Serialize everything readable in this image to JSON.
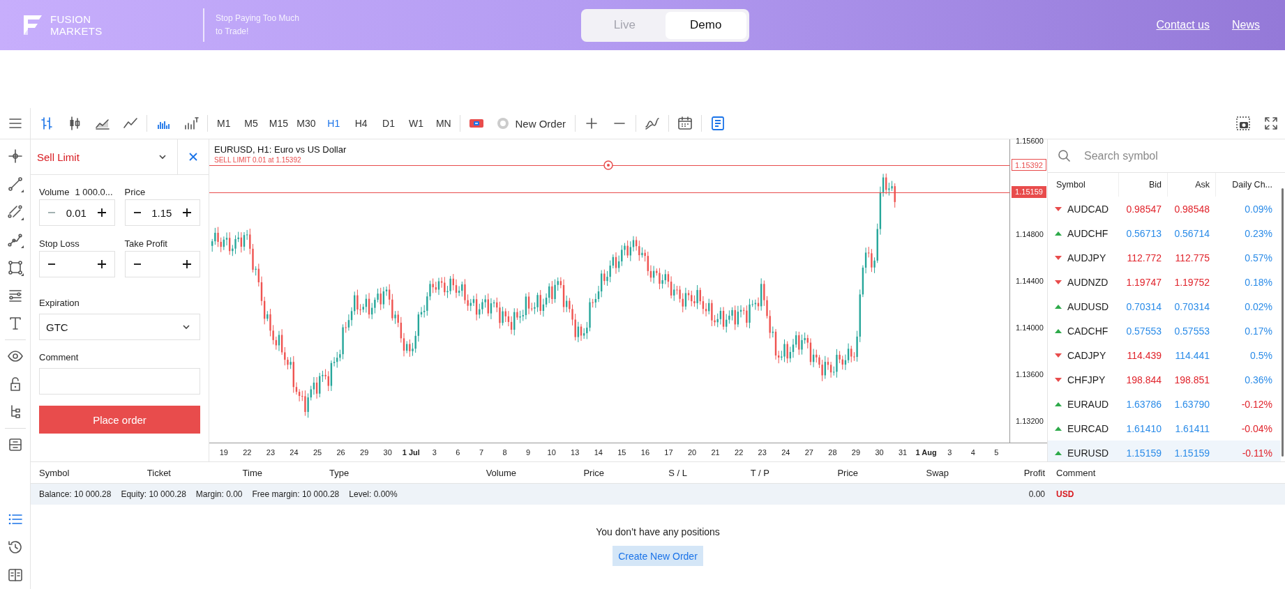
{
  "header": {
    "brand_line1": "FUSION",
    "brand_line2": "MARKETS",
    "tagline": "Stop Paying Too Much to Trade!",
    "account_modes": [
      {
        "label": "Live",
        "selected": false
      },
      {
        "label": "Demo",
        "selected": true
      }
    ],
    "links": [
      "Contact us",
      "News"
    ]
  },
  "toolbar": {
    "chart_types": [
      {
        "selected": true
      },
      {
        "selected": false
      },
      {
        "selected": false
      },
      {
        "selected": false
      }
    ],
    "timeframes": [
      {
        "label": "M1",
        "selected": false
      },
      {
        "label": "M5",
        "selected": false
      },
      {
        "label": "M15",
        "selected": false
      },
      {
        "label": "M30",
        "selected": false
      },
      {
        "label": "H1",
        "selected": true
      },
      {
        "label": "H4",
        "selected": false
      },
      {
        "label": "D1",
        "selected": false
      },
      {
        "label": "W1",
        "selected": false
      },
      {
        "label": "MN",
        "selected": false
      }
    ],
    "new_order": "New Order"
  },
  "rail_bottom": [
    {
      "selected": true
    },
    {
      "selected": false
    },
    {
      "selected": false
    }
  ],
  "order_panel": {
    "order_type": "Sell Limit",
    "volume": {
      "label": "Volume",
      "hint": "1 000.0...",
      "value": "0.01",
      "minus_disabled": true
    },
    "price": {
      "label": "Price",
      "value": "1.15",
      "minus_disabled": false
    },
    "stop_loss": {
      "label": "Stop Loss",
      "minus_disabled": false
    },
    "take_profit": {
      "label": "Take Profit",
      "minus_disabled": false
    },
    "expiration": {
      "label": "Expiration",
      "value": "GTC"
    },
    "comment": {
      "label": "Comment"
    },
    "submit": "Place order"
  },
  "chart": {
    "title": "EURUSD, H1: Euro vs US Dollar",
    "order_line_label": "SELL LIMIT 0.01 at 1.15392",
    "order_price_tag": "1.15392",
    "current_price_tag": "1.15159",
    "price_axis": [
      "1.15600",
      "1.14800",
      "1.14400",
      "1.14000",
      "1.13600",
      "1.13200"
    ],
    "time_axis": [
      {
        "label": "19",
        "bold": false
      },
      {
        "label": "22",
        "bold": false
      },
      {
        "label": "23",
        "bold": false
      },
      {
        "label": "24",
        "bold": false
      },
      {
        "label": "25",
        "bold": false
      },
      {
        "label": "26",
        "bold": false
      },
      {
        "label": "29",
        "bold": false
      },
      {
        "label": "30",
        "bold": false
      },
      {
        "label": "1 Jul",
        "bold": true
      },
      {
        "label": "3",
        "bold": false
      },
      {
        "label": "6",
        "bold": false
      },
      {
        "label": "7",
        "bold": false
      },
      {
        "label": "8",
        "bold": false
      },
      {
        "label": "9",
        "bold": false
      },
      {
        "label": "10",
        "bold": false
      },
      {
        "label": "13",
        "bold": false
      },
      {
        "label": "14",
        "bold": false
      },
      {
        "label": "15",
        "bold": false
      },
      {
        "label": "16",
        "bold": false
      },
      {
        "label": "17",
        "bold": false
      },
      {
        "label": "20",
        "bold": false
      },
      {
        "label": "21",
        "bold": false
      },
      {
        "label": "22",
        "bold": false
      },
      {
        "label": "23",
        "bold": false
      },
      {
        "label": "24",
        "bold": false
      },
      {
        "label": "27",
        "bold": false
      },
      {
        "label": "28",
        "bold": false
      },
      {
        "label": "29",
        "bold": false
      },
      {
        "label": "30",
        "bold": false
      },
      {
        "label": "31",
        "bold": false
      },
      {
        "label": "1 Aug",
        "bold": true
      },
      {
        "label": "3",
        "bold": false
      },
      {
        "label": "4",
        "bold": false
      },
      {
        "label": "5",
        "bold": false
      }
    ]
  },
  "watchlist": {
    "search_placeholder": "Search symbol",
    "columns": [
      "Symbol",
      "Bid",
      "Ask",
      "Daily Ch..."
    ],
    "rows": [
      {
        "symbol": "AUDCAD",
        "rising": false,
        "bid": "0.98547",
        "bid_rising": false,
        "ask": "0.98548",
        "ask_rising": false,
        "daily_change": "0.09%",
        "change_negative": false,
        "selected": false
      },
      {
        "symbol": "AUDCHF",
        "rising": true,
        "bid": "0.56713",
        "bid_rising": true,
        "ask": "0.56714",
        "ask_rising": true,
        "daily_change": "0.23%",
        "change_negative": false,
        "selected": false
      },
      {
        "symbol": "AUDJPY",
        "rising": false,
        "bid": "112.772",
        "bid_rising": false,
        "ask": "112.775",
        "ask_rising": false,
        "daily_change": "0.57%",
        "change_negative": false,
        "selected": false
      },
      {
        "symbol": "AUDNZD",
        "rising": false,
        "bid": "1.19747",
        "bid_rising": false,
        "ask": "1.19752",
        "ask_rising": false,
        "daily_change": "0.18%",
        "change_negative": false,
        "selected": false
      },
      {
        "symbol": "AUDUSD",
        "rising": true,
        "bid": "0.70314",
        "bid_rising": true,
        "ask": "0.70314",
        "ask_rising": true,
        "daily_change": "0.02%",
        "change_negative": false,
        "selected": false
      },
      {
        "symbol": "CADCHF",
        "rising": true,
        "bid": "0.57553",
        "bid_rising": true,
        "ask": "0.57553",
        "ask_rising": true,
        "daily_change": "0.17%",
        "change_negative": false,
        "selected": false
      },
      {
        "symbol": "CADJPY",
        "rising": false,
        "bid": "114.439",
        "bid_rising": false,
        "ask": "114.441",
        "ask_rising": true,
        "daily_change": "0.5%",
        "change_negative": false,
        "selected": false
      },
      {
        "symbol": "CHFJPY",
        "rising": false,
        "bid": "198.844",
        "bid_rising": false,
        "ask": "198.851",
        "ask_rising": false,
        "daily_change": "0.36%",
        "change_negative": false,
        "selected": false
      },
      {
        "symbol": "EURAUD",
        "rising": true,
        "bid": "1.63786",
        "bid_rising": true,
        "ask": "1.63790",
        "ask_rising": true,
        "daily_change": "-0.12%",
        "change_negative": true,
        "selected": false
      },
      {
        "symbol": "EURCAD",
        "rising": true,
        "bid": "1.61410",
        "bid_rising": true,
        "ask": "1.61411",
        "ask_rising": true,
        "daily_change": "-0.04%",
        "change_negative": true,
        "selected": false
      },
      {
        "symbol": "EURUSD",
        "rising": true,
        "bid": "1.15159",
        "bid_rising": true,
        "ask": "1.15159",
        "ask_rising": true,
        "daily_change": "-0.11%",
        "change_negative": true,
        "selected": true
      }
    ]
  },
  "positions": {
    "columns": [
      "Symbol",
      "Ticket",
      "Time",
      "Type",
      "Volume",
      "Price",
      "S / L",
      "T / P",
      "Price",
      "Swap",
      "Profit",
      "Comment"
    ],
    "summary": [
      "Balance: 10 000.28",
      "Equity: 10 000.28",
      "Margin: 0.00",
      "Free margin: 10 000.28",
      "Level: 0.00%"
    ],
    "profit": "0.00",
    "currency": "USD",
    "empty_message": "You don’t have any positions",
    "create_button": "Create New Order"
  }
}
